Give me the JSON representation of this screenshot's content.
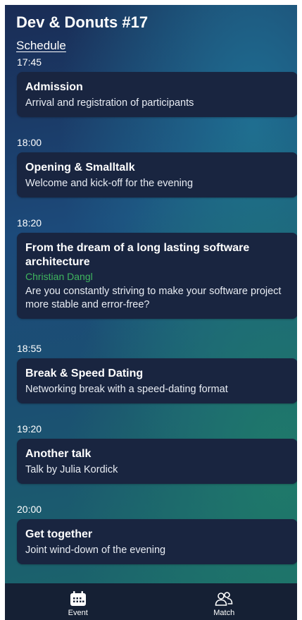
{
  "header": {
    "title": "Dev & Donuts #17",
    "subtitle": "Schedule"
  },
  "schedule": [
    {
      "time": "17:45",
      "title": "Admission",
      "speaker": "",
      "description": "Arrival and registration of participants"
    },
    {
      "time": "18:00",
      "title": "Opening & Smalltalk",
      "speaker": "",
      "description": "Welcome and kick-off for the evening"
    },
    {
      "time": "18:20",
      "title": "From the dream of a long lasting software architecture",
      "speaker": "Christian Dangl",
      "description": "Are you constantly striving to make your software project more stable and error-free?"
    },
    {
      "time": "18:55",
      "title": "Break & Speed Dating",
      "speaker": "",
      "description": "Networking break with a speed-dating format"
    },
    {
      "time": "19:20",
      "title": "Another talk",
      "speaker": "",
      "description": "Talk by Julia Kordick"
    },
    {
      "time": "20:00",
      "title": "Get together",
      "speaker": "",
      "description": "Joint wind-down of the evening"
    }
  ],
  "tabs": [
    {
      "label": "Event",
      "icon": "calendar-icon"
    },
    {
      "label": "Match",
      "icon": "people-icon"
    }
  ],
  "colors": {
    "card": "#192540",
    "speaker": "#3fb55e",
    "tabbar": "#152034"
  }
}
